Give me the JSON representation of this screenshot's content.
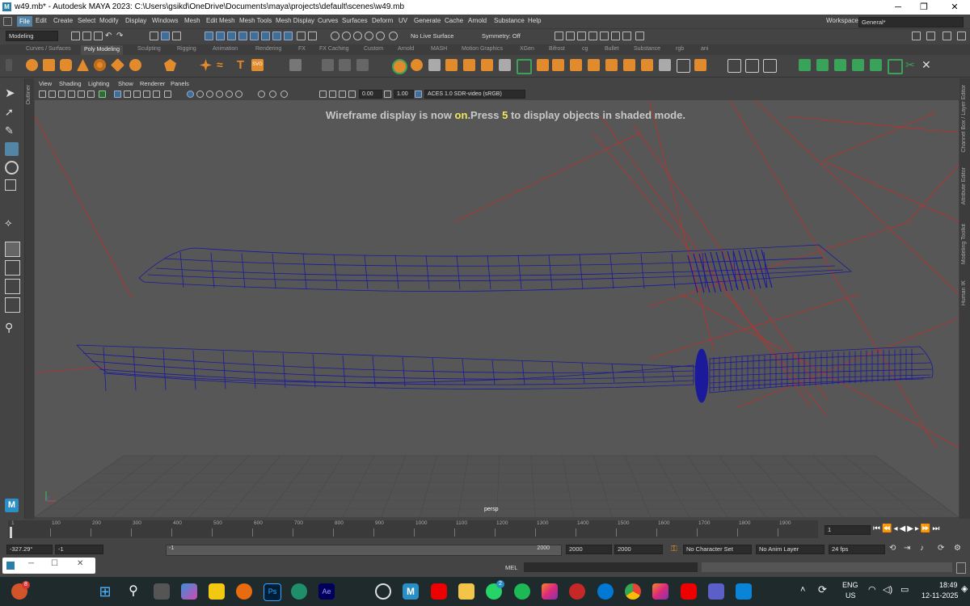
{
  "window": {
    "title": "w49.mb* - Autodesk MAYA 2023: C:\\Users\\gsikd\\OneDrive\\Documents\\maya\\projects\\default\\scenes\\w49.mb",
    "workspace_label": "Workspace :",
    "workspace_value": "General*",
    "minimize": "─",
    "maximize": "❐",
    "close": "✕"
  },
  "menubar": [
    "File",
    "Edit",
    "Create",
    "Select",
    "Modify",
    "Display",
    "Windows",
    "Mesh",
    "Edit Mesh",
    "Mesh Tools",
    "Mesh Display",
    "Curves",
    "Surfaces",
    "Deform",
    "UV",
    "Generate",
    "Cache",
    "Arnold",
    "Substance",
    "Help"
  ],
  "statusline": {
    "menuset": "Modeling",
    "live_surface": "No Live Surface",
    "symmetry": "Symmetry: Off"
  },
  "shelf_tabs": [
    "Curves / Surfaces",
    "Poly Modeling",
    "Sculpting",
    "Rigging",
    "Animation",
    "Rendering",
    "FX",
    "FX Caching",
    "Custom",
    "Arnold",
    "MASH",
    "Motion Graphics",
    "XGen",
    "Bifrost",
    "cg",
    "Bullet",
    "Substance",
    "rgb",
    "ani"
  ],
  "shelf_active": "Poly Modeling",
  "panel_menu": [
    "View",
    "Shading",
    "Lighting",
    "Show",
    "Renderer",
    "Panels"
  ],
  "panel_toolbar": {
    "exposure": "0.00",
    "gamma": "1.00",
    "colorspace": "ACES 1.0 SDR-video (sRGB)"
  },
  "viewport": {
    "hud_part1": "Wireframe display is now ",
    "hud_on": "on",
    "hud_part2": ".Press ",
    "hud_key": "5",
    "hud_part3": " to display objects in shaded mode.",
    "camera": "persp"
  },
  "side_panels": {
    "left": "Outliner",
    "right": [
      "Channel Box / Layer Editor",
      "Attribute Editor",
      "Modeling Toolkit",
      "Human IK"
    ]
  },
  "timeslider": {
    "ticks": [
      "1",
      "100",
      "200",
      "300",
      "400",
      "500",
      "600",
      "700",
      "800",
      "900",
      "1000",
      "1100",
      "1200",
      "1300",
      "1400",
      "1500",
      "1600",
      "1700",
      "1800",
      "1900"
    ],
    "current_frame": "1",
    "current_field": "1"
  },
  "range": {
    "start": "-327.29°",
    "start2": "-1",
    "slider_start": "-1",
    "slider_end": "2000",
    "end1": "2000",
    "end2": "2000",
    "character_set": "No Character Set",
    "anim_layer": "No Anim Layer",
    "fps": "24 fps"
  },
  "cmdline": {
    "mel": "MEL"
  },
  "taskbar": {
    "notif_badge": "8",
    "whatsapp_badge": "2",
    "lang": "ENG",
    "region": "US",
    "time": "18:49",
    "date": "12-11-2025"
  },
  "colors": {
    "wire": "#1a1a9a",
    "red_lines": "#c0302a",
    "accent": "#5285a6"
  }
}
